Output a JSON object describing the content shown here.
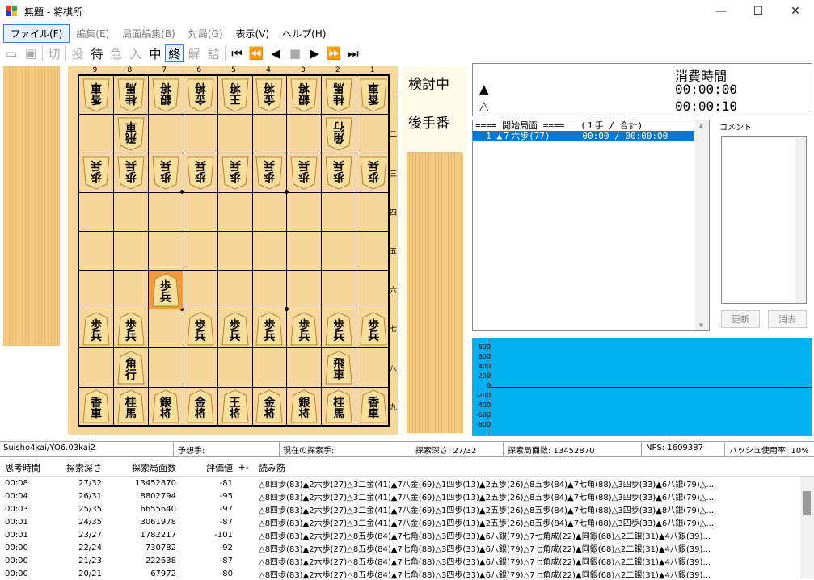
{
  "window": {
    "title": "無題 - 将棋所",
    "min": "—",
    "max": "☐",
    "close": "✕"
  },
  "menu": [
    "ファイル(F)",
    "編集(E)",
    "局面編集(B)",
    "対局(G)",
    "表示(V)",
    "ヘルプ(H)"
  ],
  "toolbar": [
    "切",
    "投",
    "待",
    "急",
    "入",
    "中",
    "終",
    "解",
    "詰"
  ],
  "board": {
    "col_labels": [
      "9",
      "8",
      "7",
      "6",
      "5",
      "4",
      "3",
      "2",
      "1"
    ],
    "row_labels": [
      "一",
      "二",
      "三",
      "四",
      "五",
      "六",
      "七",
      "八",
      "九"
    ],
    "pieces": [
      {
        "c": 0,
        "r": 0,
        "t": "香車",
        "side": "gote"
      },
      {
        "c": 1,
        "r": 0,
        "t": "桂馬",
        "side": "gote"
      },
      {
        "c": 2,
        "r": 0,
        "t": "銀将",
        "side": "gote"
      },
      {
        "c": 3,
        "r": 0,
        "t": "金将",
        "side": "gote"
      },
      {
        "c": 4,
        "r": 0,
        "t": "王将",
        "side": "gote"
      },
      {
        "c": 5,
        "r": 0,
        "t": "金将",
        "side": "gote"
      },
      {
        "c": 6,
        "r": 0,
        "t": "銀将",
        "side": "gote"
      },
      {
        "c": 7,
        "r": 0,
        "t": "桂馬",
        "side": "gote"
      },
      {
        "c": 8,
        "r": 0,
        "t": "香車",
        "side": "gote"
      },
      {
        "c": 1,
        "r": 1,
        "t": "飛車",
        "side": "gote"
      },
      {
        "c": 7,
        "r": 1,
        "t": "角行",
        "side": "gote"
      },
      {
        "c": 0,
        "r": 2,
        "t": "歩兵",
        "side": "gote"
      },
      {
        "c": 1,
        "r": 2,
        "t": "歩兵",
        "side": "gote"
      },
      {
        "c": 2,
        "r": 2,
        "t": "歩兵",
        "side": "gote"
      },
      {
        "c": 3,
        "r": 2,
        "t": "歩兵",
        "side": "gote"
      },
      {
        "c": 4,
        "r": 2,
        "t": "歩兵",
        "side": "gote"
      },
      {
        "c": 5,
        "r": 2,
        "t": "歩兵",
        "side": "gote"
      },
      {
        "c": 6,
        "r": 2,
        "t": "歩兵",
        "side": "gote"
      },
      {
        "c": 7,
        "r": 2,
        "t": "歩兵",
        "side": "gote"
      },
      {
        "c": 8,
        "r": 2,
        "t": "歩兵",
        "side": "gote"
      },
      {
        "c": 2,
        "r": 5,
        "t": "歩兵",
        "side": "sente",
        "hl": true
      },
      {
        "c": 0,
        "r": 6,
        "t": "歩兵",
        "side": "sente"
      },
      {
        "c": 1,
        "r": 6,
        "t": "歩兵",
        "side": "sente"
      },
      {
        "c": 3,
        "r": 6,
        "t": "歩兵",
        "side": "sente"
      },
      {
        "c": 4,
        "r": 6,
        "t": "歩兵",
        "side": "sente"
      },
      {
        "c": 5,
        "r": 6,
        "t": "歩兵",
        "side": "sente"
      },
      {
        "c": 6,
        "r": 6,
        "t": "歩兵",
        "side": "sente"
      },
      {
        "c": 7,
        "r": 6,
        "t": "歩兵",
        "side": "sente"
      },
      {
        "c": 8,
        "r": 6,
        "t": "歩兵",
        "side": "sente"
      },
      {
        "c": 1,
        "r": 7,
        "t": "角行",
        "side": "sente"
      },
      {
        "c": 7,
        "r": 7,
        "t": "飛車",
        "side": "sente"
      },
      {
        "c": 0,
        "r": 8,
        "t": "香車",
        "side": "sente"
      },
      {
        "c": 1,
        "r": 8,
        "t": "桂馬",
        "side": "sente"
      },
      {
        "c": 2,
        "r": 8,
        "t": "銀将",
        "side": "sente"
      },
      {
        "c": 3,
        "r": 8,
        "t": "金将",
        "side": "sente"
      },
      {
        "c": 4,
        "r": 8,
        "t": "王将",
        "side": "sente"
      },
      {
        "c": 5,
        "r": 8,
        "t": "金将",
        "side": "sente"
      },
      {
        "c": 6,
        "r": 8,
        "t": "銀将",
        "side": "sente"
      },
      {
        "c": 7,
        "r": 8,
        "t": "桂馬",
        "side": "sente"
      },
      {
        "c": 8,
        "r": 8,
        "t": "香車",
        "side": "sente"
      }
    ]
  },
  "status": {
    "mode": "検討中",
    "turn": "後手番"
  },
  "time": {
    "header": "消費時間",
    "sente_mark": "▲",
    "gote_mark": "△",
    "sente_time": "00:00:00",
    "gote_time": "00:00:10"
  },
  "kifu": {
    "header": "==== 開始局面 ====   (１手 / 合計)",
    "move1": "  1 ▲７六歩(77)      00:00 / 00:00:00"
  },
  "comment": {
    "label": "コメント",
    "update": "更新",
    "delete": "消去"
  },
  "graph": {
    "labels": [
      "800",
      "600",
      "400",
      "200",
      "0",
      "-200",
      "-400",
      "-600",
      "-800"
    ]
  },
  "statusbar": {
    "engine": "Suisho4kai/YO6.03kai2",
    "predict": "予想手:",
    "current": "現在の探索手:",
    "depth": "探索深さ: 27/32",
    "nodes": "探索局面数: 13452870",
    "nps": "NPS: 1609387",
    "hash": "ハッシュ使用率: 10%"
  },
  "table": {
    "headers": [
      "思考時間",
      "探索深さ",
      "探索局面数",
      "評価値",
      "+-",
      "読み筋"
    ],
    "rows": [
      [
        "00:08",
        "27/32",
        "13452870",
        "-81",
        "",
        "△8四歩(83)▲2六歩(27)△3二金(41)▲7八金(69)△1四歩(13)▲2五歩(26)△8五歩(84)▲7七角(88)△3四歩(33)▲6八銀(79)△..."
      ],
      [
        "00:04",
        "26/31",
        "8802794",
        "-95",
        "",
        "△8四歩(83)▲2六歩(27)△3二金(41)▲7八金(69)△1四歩(13)▲2五歩(26)△8五歩(84)▲7七角(88)△3四歩(33)▲6八銀(79)△..."
      ],
      [
        "00:03",
        "25/35",
        "6655640",
        "-97",
        "",
        "△8四歩(83)▲2六歩(27)△3二金(41)▲7八金(69)△1四歩(13)▲2五歩(26)△8五歩(84)▲7七角(88)△3四歩(33)▲8八銀(79)△..."
      ],
      [
        "00:01",
        "24/35",
        "3061978",
        "-87",
        "",
        "△8四歩(83)▲2六歩(27)△3二金(41)▲7八金(69)△1四歩(13)▲2五歩(26)△8五歩(84)▲7七角(88)△3四歩(33)▲6八銀(79)△..."
      ],
      [
        "00:01",
        "23/27",
        "1782217",
        "-101",
        "",
        "△8四歩(83)▲2六歩(27)△8五歩(84)▲7七角(88)△3四歩(33)▲6八銀(79)△7七角成(22)▲同銀(68)△2二銀(31)▲4八銀(39)..."
      ],
      [
        "00:00",
        "22/24",
        "730782",
        "-92",
        "",
        "△8四歩(83)▲2六歩(27)△8五歩(84)▲7七角(88)△3四歩(33)▲6八銀(79)△7七角成(22)▲同銀(68)△2二銀(31)▲4八銀(39)..."
      ],
      [
        "00:00",
        "21/23",
        "222638",
        "-87",
        "",
        "△8四歩(83)▲2六歩(27)△8五歩(84)▲7七角(88)△3四歩(33)▲6八銀(79)△7七角成(22)▲同銀(68)△2二銀(31)▲4八銀(39)..."
      ],
      [
        "00:00",
        "20/21",
        "67972",
        "-80",
        "",
        "△8四歩(83)▲2六歩(27)△8五歩(84)▲7七角(88)△3四歩(33)▲6八銀(79)△7七角成(22)▲同銀(68)△2二銀(31)▲4八銀(39)..."
      ]
    ]
  }
}
